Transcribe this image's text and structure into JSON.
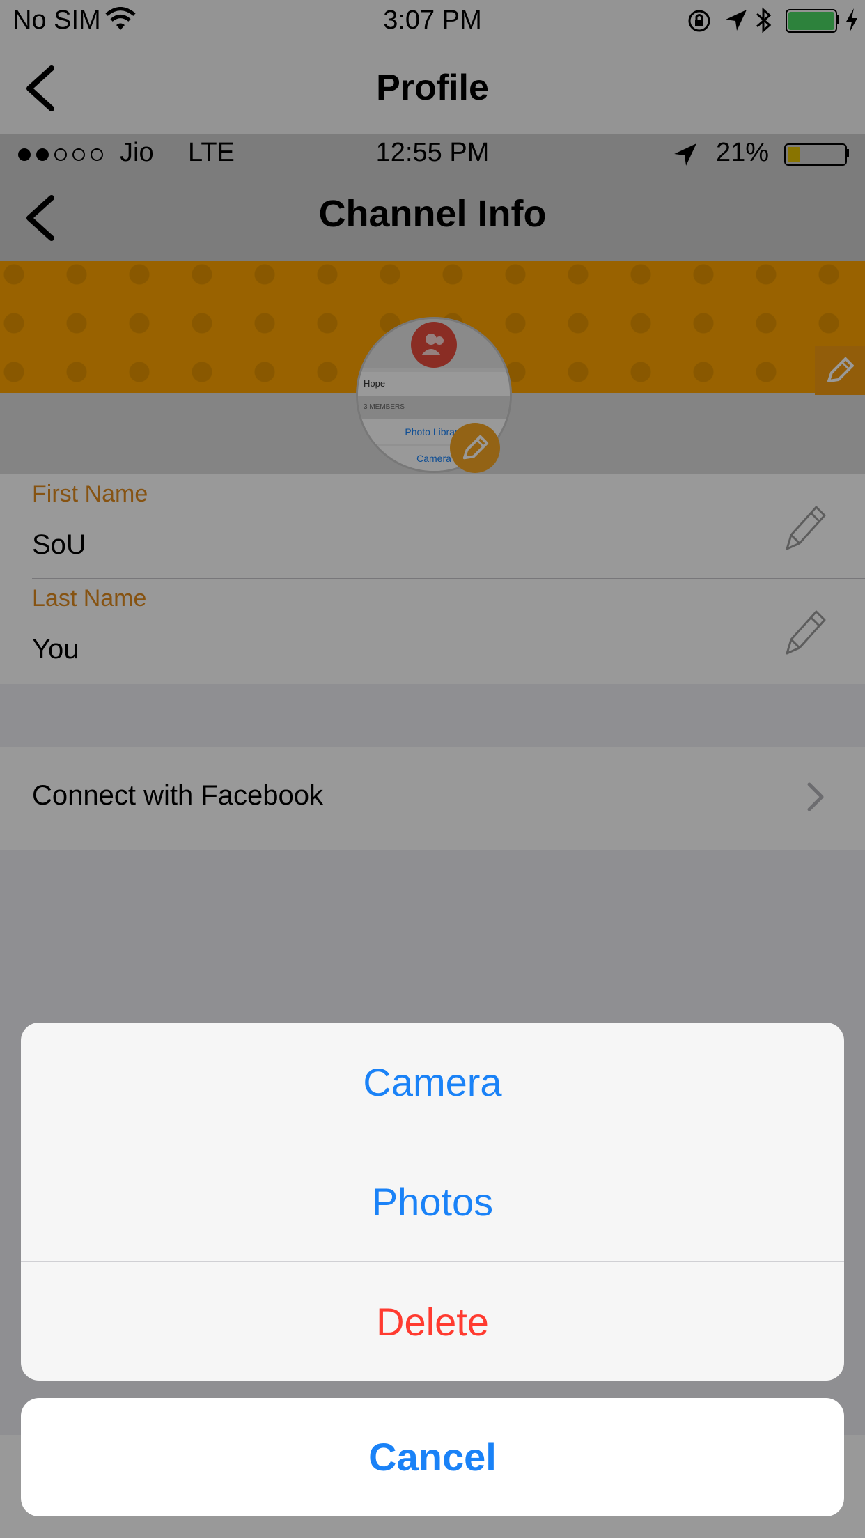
{
  "status_bar": {
    "carrier": "No SIM",
    "time": "3:07 PM"
  },
  "nav": {
    "title": "Profile"
  },
  "embedded_screenshot": {
    "carrier": "Jio",
    "network": "LTE",
    "time": "12:55 PM",
    "battery": "21%",
    "title": "Channel Info",
    "avatar_rows": [
      "Hope",
      "3 MEMBERS"
    ],
    "avatar_links": [
      "Photo Library",
      "Camera"
    ]
  },
  "form": {
    "first_name_label": "First Name",
    "first_name_value": "SoU",
    "last_name_label": "Last Name",
    "last_name_value": "You"
  },
  "connect": {
    "label": "Connect with Facebook"
  },
  "action_sheet": {
    "camera": "Camera",
    "photos": "Photos",
    "delete": "Delete",
    "cancel": "Cancel"
  },
  "colors": {
    "accent_orange": "#e08a1e",
    "ios_blue": "#1a82f7",
    "destructive_red": "#ff3b30",
    "battery_green": "#4cd964"
  }
}
